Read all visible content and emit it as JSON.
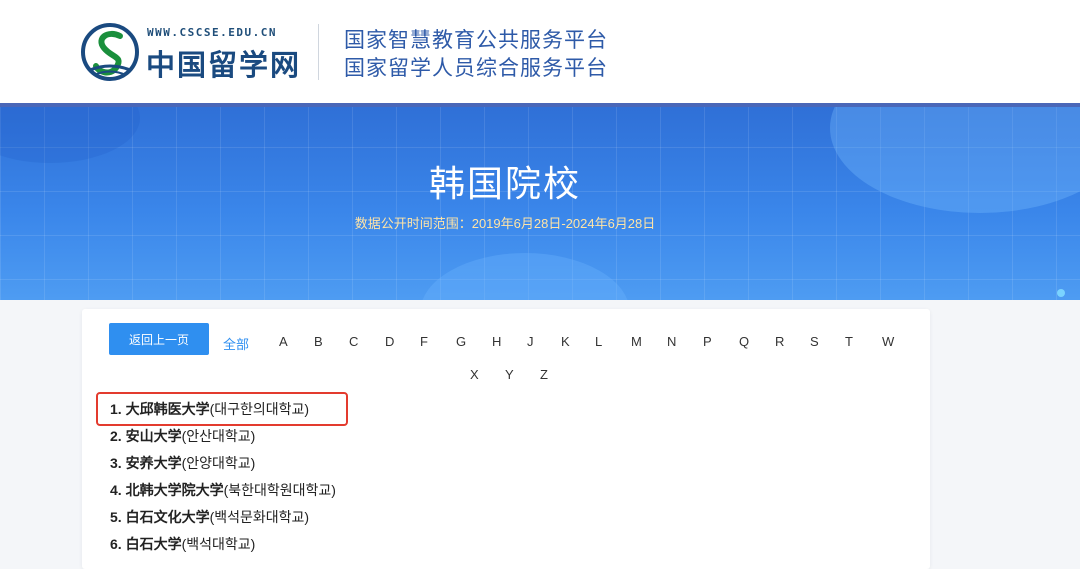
{
  "header": {
    "logo_url": "WWW.CSCSE.EDU.CN",
    "logo_name": "中国留学网",
    "title_line1": "国家智慧教育公共服务平台",
    "title_line2": "国家留学人员综合服务平台"
  },
  "banner": {
    "title": "韩国院校",
    "subtitle": "数据公开时间范围：2019年6月28日-2024年6月28日"
  },
  "nav": {
    "back_label": "返回上一页",
    "all_label": "全部",
    "letters": [
      "A",
      "B",
      "C",
      "D",
      "F",
      "G",
      "H",
      "J",
      "K",
      "L",
      "M",
      "N",
      "P",
      "Q",
      "R",
      "S",
      "T",
      "W",
      "X",
      "Y",
      "Z"
    ]
  },
  "schools": [
    {
      "num": "1.",
      "name": "大邱韩医大学",
      "korean": "(대구한의대학교)"
    },
    {
      "num": "2.",
      "name": "安山大学",
      "korean": "(안산대학교)"
    },
    {
      "num": "3.",
      "name": "安养大学",
      "korean": "(안양대학교)"
    },
    {
      "num": "4.",
      "name": "北韩大学院大学",
      "korean": "(북한대학원대학교)"
    },
    {
      "num": "5.",
      "name": "白石文化大学",
      "korean": "(백석문화대학교)"
    },
    {
      "num": "6.",
      "name": "白石大学",
      "korean": "(백석대학교)"
    }
  ],
  "colors": {
    "accent": "#2f8ff0",
    "banner": "#3a86ea",
    "highlight": "#e33b2e",
    "subtitle": "#ffe4a6"
  }
}
